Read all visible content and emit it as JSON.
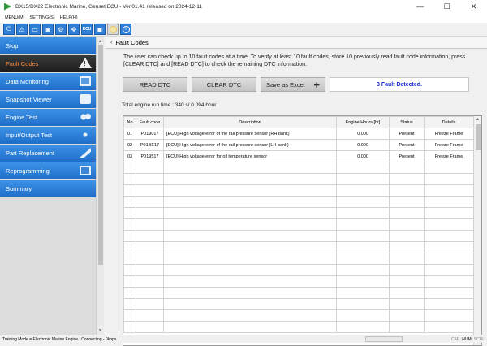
{
  "window": {
    "title": "DX15/DX22 Electronic Marine, Genset ECU - Ver.01.41 released on 2024-12-11",
    "controls": [
      "—",
      "☐",
      "✕"
    ]
  },
  "menu": [
    "MENU(M)",
    "SETTING(S)",
    "HELP(H)"
  ],
  "toolbar": {
    "ecu_label": "ECU",
    "icons": [
      "power-icon",
      "warning-icon",
      "monitor-icon",
      "camera-icon",
      "gears-icon",
      "arrows-icon",
      "ecu-icon",
      "chip-icon",
      "disc-icon",
      "info-icon"
    ]
  },
  "sidebar": {
    "items": [
      {
        "label": "Stop",
        "icon": ""
      },
      {
        "label": "Fault Codes",
        "icon": "warning-icon"
      },
      {
        "label": "Data Monitoring",
        "icon": "monitor-icon"
      },
      {
        "label": "Snapshot Viewer",
        "icon": "camera-icon"
      },
      {
        "label": "Engine Test",
        "icon": "gears-icon"
      },
      {
        "label": "Input/Output Test",
        "icon": "arrows-icon"
      },
      {
        "label": "Part Replacement",
        "icon": "wrench-icon"
      },
      {
        "label": "Reprogramming",
        "icon": "chip-icon"
      },
      {
        "label": "Summary",
        "icon": ""
      }
    ]
  },
  "panel": {
    "title": "Fault Codes",
    "description": "The user can check up to 10 fault codes at a time. To verify at least 10 fault codes, store 10 previously read fault code information, press [CLEAR DTC] and [READ DTC] to check the remaining DTC information.",
    "buttons": {
      "read": "READ DTC",
      "clear": "CLEAR DTC",
      "excel": "Save as Excel",
      "excel_plus": "+"
    },
    "status": "3 Fault Detected.",
    "runtime": "Total engine run time : 340 s/ 0.094 hour"
  },
  "table": {
    "headers": [
      "No",
      "Fault code",
      "Description",
      "Engine Hours [hr]",
      "Status",
      "Details"
    ],
    "rows": [
      [
        "01",
        "P019017",
        "[ECU] High voltage error of the rail pressure sensor (RH bank)",
        "0.000",
        "Present",
        "Freeze Frame"
      ],
      [
        "02",
        "P01BE17",
        "[ECU] High voltage error of the rail pressure sensor (LH bank)",
        "0.000",
        "Present",
        "Freeze Frame"
      ],
      [
        "03",
        "P019517",
        "[ECU] High voltage error for oil temperature sensor",
        "0.000",
        "Present",
        "Freeze Frame"
      ]
    ]
  },
  "statusbar": {
    "message": "Training Mode = Electronic Marine Engine : Connecting - 0kbps",
    "indicators": [
      "CAP",
      "NUM",
      "SCRL"
    ]
  },
  "colors": {
    "accent": "#2f7fd6",
    "active_text": "#ff8a3a",
    "status_text": "#1a2bd0"
  }
}
